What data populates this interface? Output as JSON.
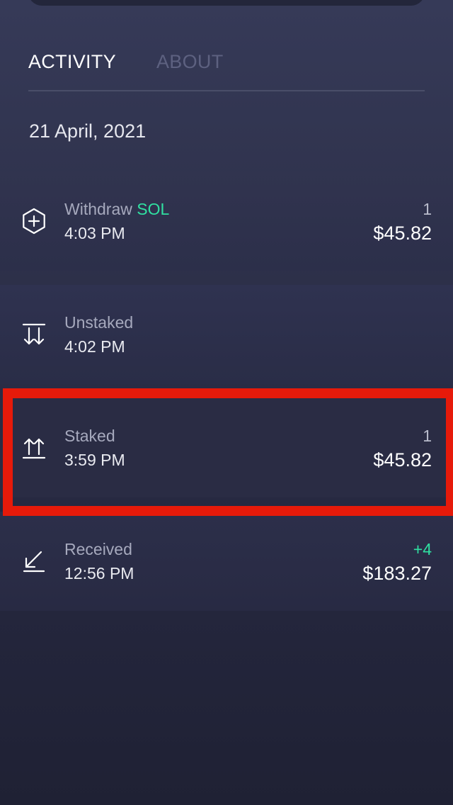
{
  "tabs": [
    {
      "label": "ACTIVITY",
      "active": true
    },
    {
      "label": "ABOUT",
      "active": false
    }
  ],
  "date": "21 April, 2021",
  "colors": {
    "accent_green": "#30e0a1",
    "highlight_red": "#e61a0a",
    "tab_inactive": "#5d6180"
  },
  "transactions": [
    {
      "icon": "withdraw-hexagon-plus-icon",
      "action": "Withdraw",
      "token": "SOL",
      "time": "4:03 PM",
      "amount": "1",
      "fiat": "$45.82"
    },
    {
      "icon": "unstake-arrows-down-icon",
      "action": "Unstaked",
      "token": "",
      "time": "4:02 PM",
      "amount": "",
      "fiat": ""
    },
    {
      "icon": "stake-arrows-up-icon",
      "action": "Staked",
      "token": "",
      "time": "3:59 PM",
      "amount": "1",
      "fiat": "$45.82"
    },
    {
      "icon": "received-arrow-down-left-icon",
      "action": "Received",
      "token": "",
      "time": "12:56 PM",
      "amount": "+4",
      "fiat": "$183.27"
    }
  ]
}
